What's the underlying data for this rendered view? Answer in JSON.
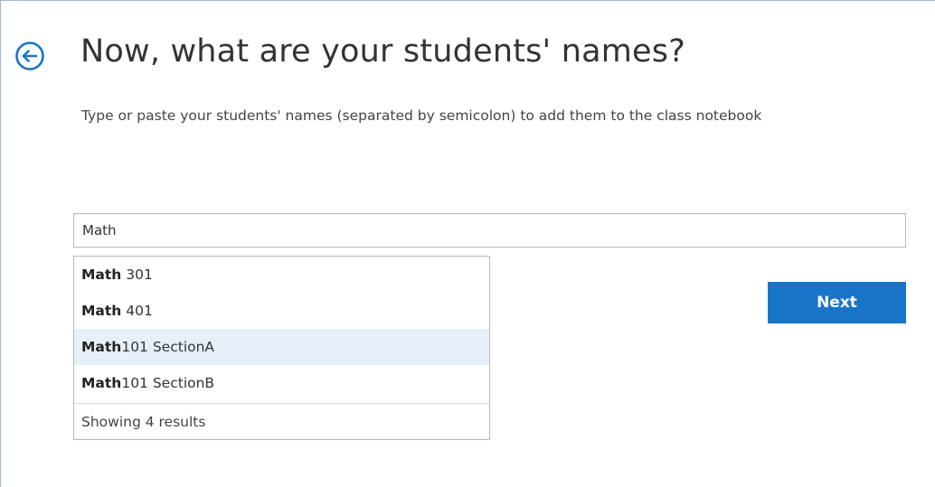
{
  "header": {
    "title": "Now, what are your students' names?",
    "subtitle": "Type or paste your students' names (separated by semicolon) to add them to the class notebook",
    "back_icon": "back-arrow-circle-icon"
  },
  "names_input": {
    "value": "Math"
  },
  "suggestions": {
    "items": [
      {
        "match": "Math",
        "rest": " 301"
      },
      {
        "match": "Math",
        "rest": " 401"
      },
      {
        "match": "Math",
        "rest": "101 SectionA"
      },
      {
        "match": "Math",
        "rest": "101 SectionB"
      }
    ],
    "highlighted_index": 2,
    "footer": "Showing 4 results"
  },
  "actions": {
    "next_label": "Next"
  },
  "colors": {
    "accent": "#1874c7",
    "highlight": "#e7f0f8",
    "frame_border": "#9fb6cc"
  }
}
